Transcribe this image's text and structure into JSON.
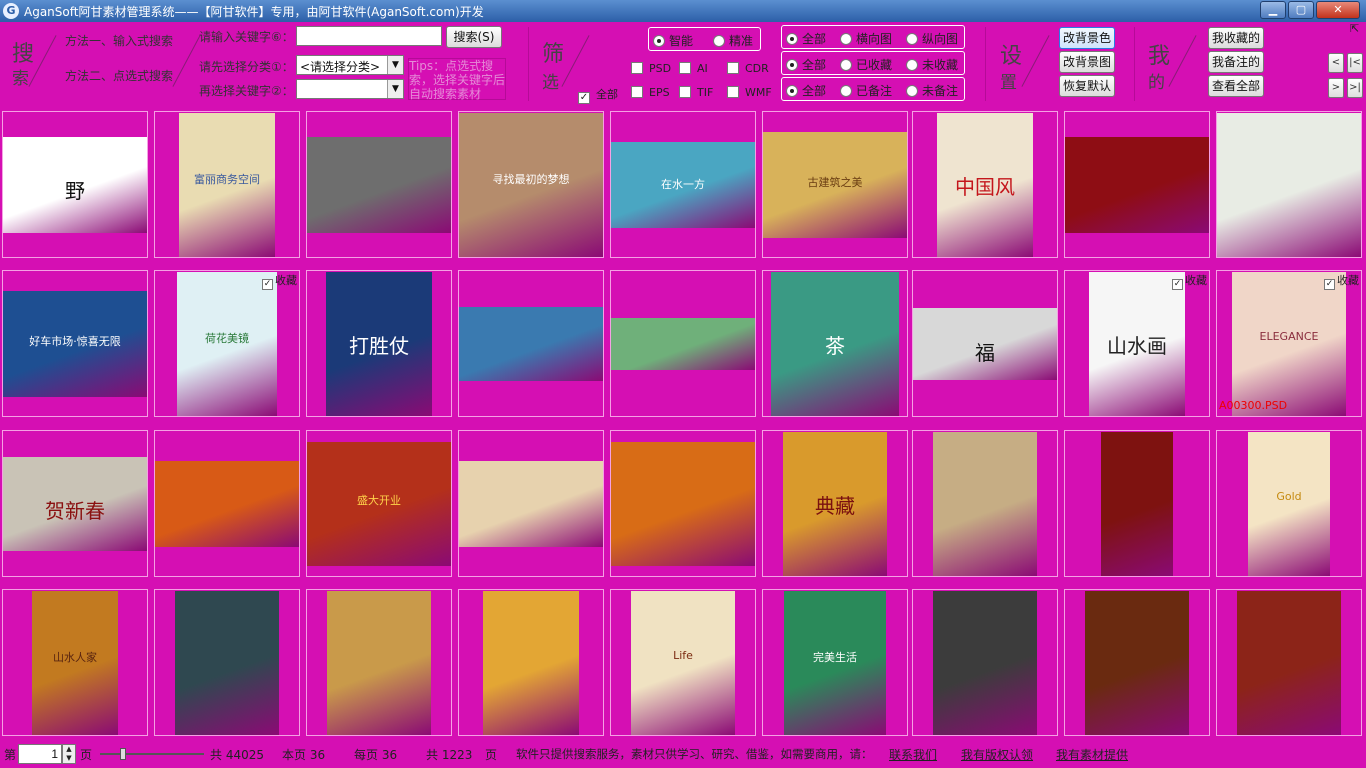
{
  "titlebar": {
    "title": "AganSoft阿甘素材管理系统——【阿甘软件】专用，由阿甘软件(AganSoft.com)开发",
    "app_icon": "G",
    "btn_min": "▁",
    "btn_max": "▢",
    "btn_close": "✕"
  },
  "toolbar": {
    "search_big_1": "搜",
    "search_big_2": "索",
    "method1": "方法一、输入式搜索",
    "method2": "方法二、点选式搜索",
    "kw_label": "请输入关键字⑥：",
    "kw_value": "",
    "search_btn": "搜索(S)",
    "cat_label": "请先选择分类①：",
    "cat_value": "<请选择分类>",
    "kw2_label": "再选择关键字②：",
    "kw2_value": "",
    "tips": "Tips：点选式搜索，选择关键字后自动搜索素材",
    "filter_big_1": "筛",
    "filter_big_2": "选",
    "match": {
      "smart": "智能",
      "exact": "精准"
    },
    "types": {
      "psd": "PSD",
      "ai": "AI",
      "cdr": "CDR",
      "all": "全部",
      "eps": "EPS",
      "tif": "TIF",
      "wmf": "WMF"
    },
    "orient": {
      "all": "全部",
      "h": "横向图",
      "v": "纵向图"
    },
    "favf": {
      "all": "全部",
      "yes": "已收藏",
      "no": "未收藏"
    },
    "notef": {
      "all": "全部",
      "yes": "已备注",
      "no": "未备注"
    },
    "set_big_1": "设",
    "set_big_2": "置",
    "bgcolor_btn": "改背景色",
    "bgimg_btn": "改背景图",
    "default_btn": "恢复默认",
    "me_big_1": "我",
    "me_big_2": "的",
    "my_fav_btn": "我收藏的",
    "my_notes_btn": "我备注的",
    "view_all_btn": "查看全部",
    "nav_prev": "<",
    "nav_first": "|<",
    "nav_next": ">",
    "nav_last": ">|",
    "pin": "⇱"
  },
  "grid": {
    "fav_label": "收藏",
    "items": [
      {
        "caption": "野",
        "bg": "#ffffff",
        "fg": "#111111",
        "w": 144,
        "h": 96
      },
      {
        "caption": "富丽商务空间",
        "bg": "#e9dcb2",
        "fg": "#3a5a9e",
        "w": 96,
        "h": 144
      },
      {
        "caption": "",
        "bg": "#6e6e6e",
        "fg": "#ffffff",
        "w": 144,
        "h": 96
      },
      {
        "caption": "寻找最初的梦想",
        "bg": "#b58c6c",
        "fg": "#ffffff",
        "w": 144,
        "h": 144
      },
      {
        "caption": "在水一方",
        "bg": "#4aa6c2",
        "fg": "#ffffff",
        "w": 144,
        "h": 86
      },
      {
        "caption": "古建筑之美",
        "bg": "#d8b25a",
        "fg": "#6a3d12",
        "w": 144,
        "h": 106
      },
      {
        "caption": "中国风",
        "bg": "#efe4d0",
        "fg": "#c4161c",
        "w": 96,
        "h": 144
      },
      {
        "caption": "",
        "bg": "#8e0d14",
        "fg": "#ffcc44",
        "w": 144,
        "h": 96
      },
      {
        "caption": "",
        "bg": "#e8ece4",
        "fg": "#333333",
        "w": 144,
        "h": 144
      },
      {
        "caption": "好车市场·惊喜无限",
        "bg": "#1e4f92",
        "fg": "#ffffff",
        "w": 144,
        "h": 106
      },
      {
        "caption": "荷花美镜",
        "bg": "#dff0f4",
        "fg": "#2a7a3a",
        "w": 100,
        "h": 144,
        "fav": true
      },
      {
        "caption": "打胜仗",
        "bg": "#1b3a78",
        "fg": "#ffffff",
        "w": 106,
        "h": 144
      },
      {
        "caption": "",
        "bg": "#3a7ab0",
        "fg": "#ffffff",
        "w": 144,
        "h": 74
      },
      {
        "caption": "",
        "bg": "#6fb07a",
        "fg": "#ffffff",
        "w": 144,
        "h": 52
      },
      {
        "caption": "茶",
        "bg": "#3a9a84",
        "fg": "#ffffff",
        "w": 128,
        "h": 144
      },
      {
        "caption": "福",
        "bg": "#d8d8d8",
        "fg": "#111111",
        "w": 144,
        "h": 72
      },
      {
        "caption": "山水画",
        "bg": "#f6f6f6",
        "fg": "#222222",
        "w": 96,
        "h": 144,
        "fav": true
      },
      {
        "caption": "ELEGANCE",
        "bg": "#f0d6c8",
        "fg": "#8a2d3d",
        "w": 114,
        "h": 144,
        "fav": true,
        "fname": "A00300.PSD"
      },
      {
        "caption": "贺新春",
        "bg": "#c9c3b6",
        "fg": "#8a1010",
        "w": 144,
        "h": 94
      },
      {
        "caption": "",
        "bg": "#d85a16",
        "fg": "#ffe08a",
        "w": 144,
        "h": 86
      },
      {
        "caption": "盛大开业",
        "bg": "#b4301a",
        "fg": "#ffd24a",
        "w": 144,
        "h": 124
      },
      {
        "caption": "",
        "bg": "#e7d2ae",
        "fg": "#b41a1a",
        "w": 144,
        "h": 86
      },
      {
        "caption": "",
        "bg": "#d86c16",
        "fg": "#ffffff",
        "w": 144,
        "h": 124
      },
      {
        "caption": "典藏",
        "bg": "#d99a2c",
        "fg": "#7a1010",
        "w": 104,
        "h": 144
      },
      {
        "caption": "",
        "bg": "#c6ad84",
        "fg": "#3a1f10",
        "w": 104,
        "h": 144
      },
      {
        "caption": "",
        "bg": "#7e1210",
        "fg": "#ffcc66",
        "w": 72,
        "h": 144
      },
      {
        "caption": "Gold",
        "bg": "#f4e4c4",
        "fg": "#c58a10",
        "w": 82,
        "h": 144
      },
      {
        "caption": "山水人家",
        "bg": "#c27a20",
        "fg": "#5a2510",
        "w": 86,
        "h": 144
      },
      {
        "caption": "",
        "bg": "#2f4850",
        "fg": "#ffffff",
        "w": 104,
        "h": 144
      },
      {
        "caption": "",
        "bg": "#c99a4a",
        "fg": "#ffffff",
        "w": 104,
        "h": 144
      },
      {
        "caption": "",
        "bg": "#e3a634",
        "fg": "#3a1f10",
        "w": 96,
        "h": 144
      },
      {
        "caption": "Life",
        "bg": "#f0e2c2",
        "fg": "#7a2a10",
        "w": 104,
        "h": 144
      },
      {
        "caption": "完美生活",
        "bg": "#2a8a5a",
        "fg": "#ffffff",
        "w": 102,
        "h": 144
      },
      {
        "caption": "",
        "bg": "#3c3c3c",
        "fg": "#ffffff",
        "w": 104,
        "h": 144
      },
      {
        "caption": "",
        "bg": "#6a2a10",
        "fg": "#ffd070",
        "w": 104,
        "h": 144
      },
      {
        "caption": "",
        "bg": "#8c2418",
        "fg": "#ffffff",
        "w": 104,
        "h": 144
      }
    ]
  },
  "status": {
    "page_prefix": "第",
    "page_value": "1",
    "page_suffix": "页",
    "total_items": "共 44025",
    "this_page": "本页 36",
    "per_page": "每页 36",
    "total_pages": "共 1223",
    "pages_unit": "页",
    "notice": "软件只提供搜索服务，素材只供学习、研究、借鉴，如需要商用，请：",
    "contact": "联系我们",
    "report": "我有版权认领",
    "provide": "我有素材提供",
    "slider_value": 0.2
  }
}
